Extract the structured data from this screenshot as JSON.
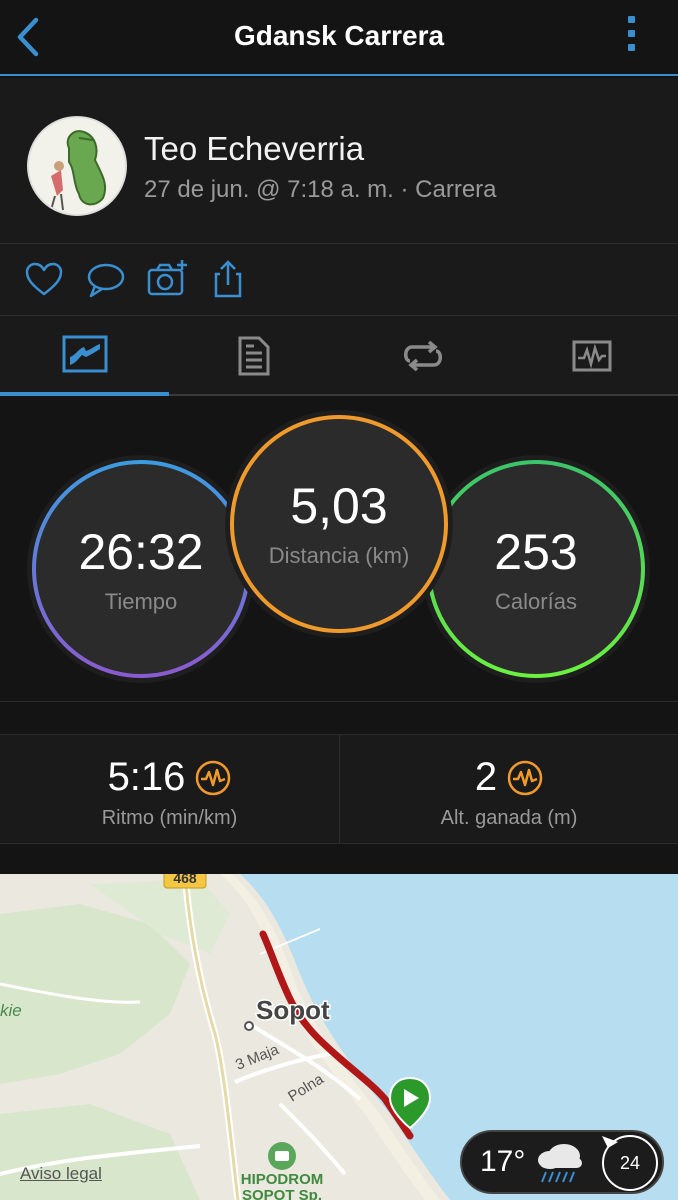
{
  "header": {
    "title": "Gdansk Carrera"
  },
  "profile": {
    "name": "Teo Echeverria",
    "meta": "27 de jun. @ 7:18 a. m. · Carrera"
  },
  "actions": [
    "heart-icon",
    "comment-icon",
    "camera-plus-icon",
    "share-icon"
  ],
  "tabs": [
    {
      "icon": "summary-stats-icon",
      "active": true
    },
    {
      "icon": "details-list-icon",
      "active": false
    },
    {
      "icon": "laps-loop-icon",
      "active": false
    },
    {
      "icon": "charts-icon",
      "active": false
    }
  ],
  "stats": {
    "time": {
      "value": "26:32",
      "label": "Tiempo"
    },
    "distance": {
      "value": "5,03",
      "label": "Distancia (km)"
    },
    "calories": {
      "value": "253",
      "label": "Calorías"
    }
  },
  "metrics": {
    "pace": {
      "value": "5:16",
      "label": "Ritmo (min/km)"
    },
    "elevation": {
      "value": "2",
      "label": "Alt. ganada (m)"
    }
  },
  "map": {
    "road_badge": "468",
    "city_label": "Sopot",
    "street_3maja": "3 Maja",
    "street_polna": "Polna",
    "poi_line1": "HIPODROM",
    "poi_line2": "SOPOT Sp.",
    "edge_text": "kie",
    "legal": "Aviso legal"
  },
  "weather": {
    "temp": "17°",
    "wind": "24"
  },
  "colors": {
    "accent": "#3a8fd0",
    "time_ring": "#6f73d6",
    "distance_ring": "#f09a2c",
    "calories_ring": "#4fd455",
    "route": "#b01818",
    "water": "#b6ddf0"
  }
}
